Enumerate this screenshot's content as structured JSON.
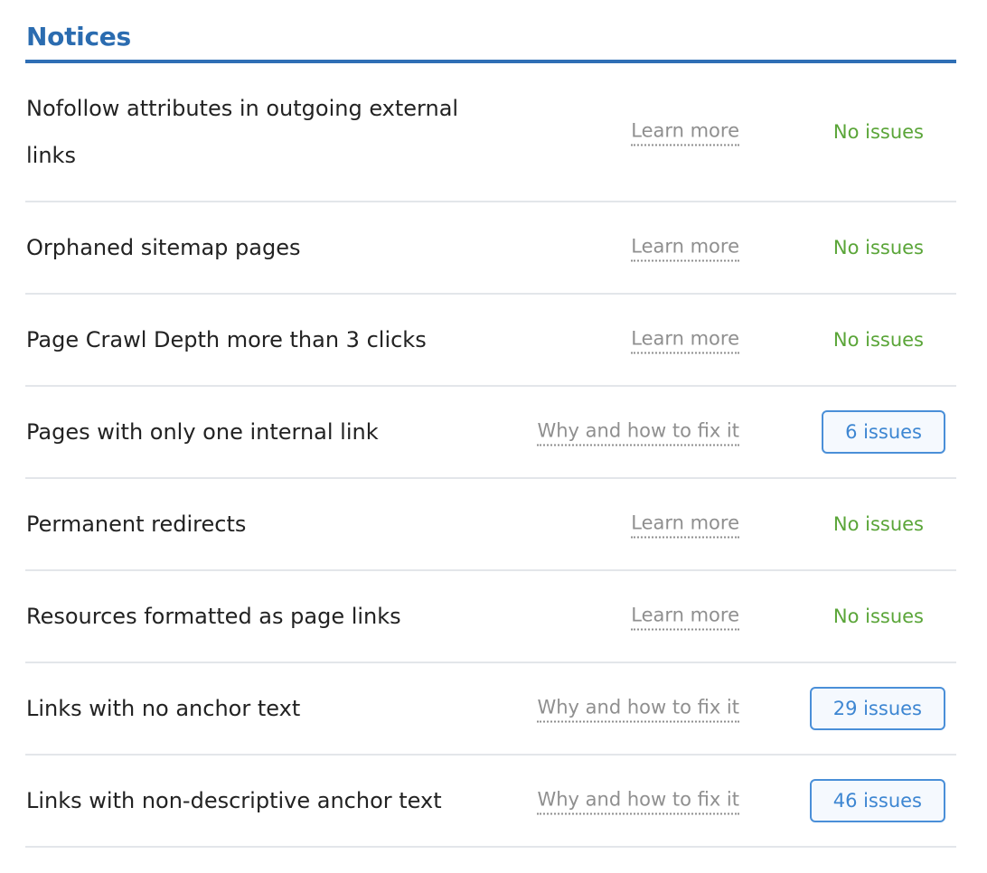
{
  "section": {
    "title": "Notices"
  },
  "rows": [
    {
      "label": "Nofollow attributes in outgoing external links",
      "link": "Learn more",
      "status": "No issues"
    },
    {
      "label": "Orphaned sitemap pages",
      "link": "Learn more",
      "status": "No issues"
    },
    {
      "label": "Page Crawl Depth more than 3 clicks",
      "link": "Learn more",
      "status": "No issues"
    },
    {
      "label": "Pages with only one internal link",
      "link": "Why and how to fix it",
      "issues": "6 issues"
    },
    {
      "label": "Permanent redirects",
      "link": "Learn more",
      "status": "No issues"
    },
    {
      "label": "Resources formatted as page links",
      "link": "Learn more",
      "status": "No issues"
    },
    {
      "label": "Links with no anchor text",
      "link": "Why and how to fix it",
      "issues": "29 issues"
    },
    {
      "label": "Links with non-descriptive anchor text",
      "link": "Why and how to fix it",
      "issues": "46 issues"
    }
  ],
  "colors": {
    "accent": "#2b6cb0",
    "ok": "#5aa538",
    "issues": "#3d86d2",
    "link": "#8f8f8f"
  }
}
